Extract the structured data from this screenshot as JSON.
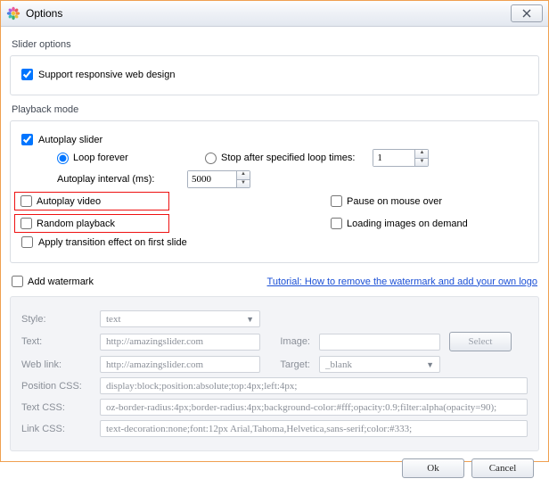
{
  "window": {
    "title": "Options"
  },
  "slider": {
    "section": "Slider options",
    "responsive": "Support responsive web design"
  },
  "playback": {
    "section": "Playback mode",
    "autoplay_slider": "Autoplay slider",
    "loop_forever": "Loop forever",
    "stop_after": "Stop after specified loop times:",
    "loop_times_value": "1",
    "interval_label": "Autoplay interval (ms):",
    "interval_value": "5000",
    "autoplay_video": "Autoplay video",
    "pause_mouse": "Pause on mouse over",
    "random_playback": "Random playback",
    "loading_demand": "Loading images on demand",
    "apply_transition": "Apply transition effect on first slide"
  },
  "watermark": {
    "add": "Add watermark",
    "tutorial": "Tutorial: How to remove the watermark and add your own logo",
    "style_label": "Style:",
    "style_value": "text",
    "text_label": "Text:",
    "text_value": "http://amazingslider.com",
    "image_label": "Image:",
    "image_value": "",
    "select_btn": "Select",
    "weblink_label": "Web link:",
    "weblink_value": "http://amazingslider.com",
    "target_label": "Target:",
    "target_value": "_blank",
    "poscss_label": "Position CSS:",
    "poscss_value": "display:block;position:absolute;top:4px;left:4px;",
    "textcss_label": "Text CSS:",
    "textcss_value": "oz-border-radius:4px;border-radius:4px;background-color:#fff;opacity:0.9;filter:alpha(opacity=90);",
    "linkcss_label": "Link CSS:",
    "linkcss_value": "text-decoration:none;font:12px Arial,Tahoma,Helvetica,sans-serif;color:#333;"
  },
  "footer": {
    "ok": "Ok",
    "cancel": "Cancel"
  }
}
